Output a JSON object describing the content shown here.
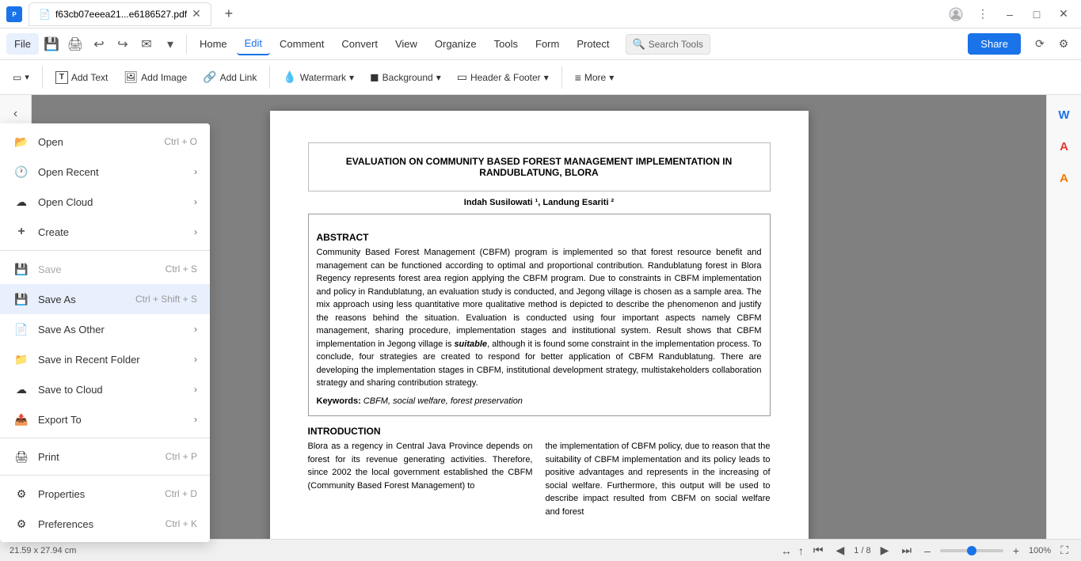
{
  "titleBar": {
    "tabTitle": "f63cb07eeea21...e6186527.pdf",
    "closeIcon": "✕",
    "addTabIcon": "+",
    "windowControls": [
      "–",
      "□",
      "✕"
    ]
  },
  "menuBar": {
    "fileLabel": "File",
    "items": [
      {
        "label": "Home",
        "active": false
      },
      {
        "label": "Edit",
        "active": true
      },
      {
        "label": "Comment",
        "active": false
      },
      {
        "label": "Convert",
        "active": false
      },
      {
        "label": "View",
        "active": false
      },
      {
        "label": "Organize",
        "active": false
      },
      {
        "label": "Tools",
        "active": false
      },
      {
        "label": "Form",
        "active": false
      },
      {
        "label": "Protect",
        "active": false
      }
    ],
    "searchPlaceholder": "Search Tools",
    "shareLabel": "Share"
  },
  "toolbar": {
    "items": [
      {
        "icon": "T",
        "label": "Add Text",
        "hasArrow": false
      },
      {
        "icon": "🖼",
        "label": "Add Image",
        "hasArrow": false
      },
      {
        "icon": "🔗",
        "label": "Add Link",
        "hasArrow": false
      },
      {
        "icon": "W",
        "label": "Watermark",
        "hasArrow": true
      },
      {
        "icon": "■",
        "label": "Background",
        "hasArrow": true
      },
      {
        "icon": "▭",
        "label": "Header & Footer",
        "hasArrow": true
      },
      {
        "icon": "≡",
        "label": "More",
        "hasArrow": true
      }
    ]
  },
  "fileMenu": {
    "items": [
      {
        "icon": "📂",
        "label": "Open",
        "shortcut": "Ctrl + O",
        "hasArrow": false,
        "disabled": false,
        "highlighted": false
      },
      {
        "icon": "🕐",
        "label": "Open Recent",
        "shortcut": "",
        "hasArrow": true,
        "disabled": false,
        "highlighted": false
      },
      {
        "icon": "☁",
        "label": "Open Cloud",
        "shortcut": "",
        "hasArrow": true,
        "disabled": false,
        "highlighted": false
      },
      {
        "icon": "+",
        "label": "Create",
        "shortcut": "",
        "hasArrow": true,
        "disabled": false,
        "highlighted": false
      },
      {
        "divider": true
      },
      {
        "icon": "💾",
        "label": "Save",
        "shortcut": "Ctrl + S",
        "hasArrow": false,
        "disabled": true,
        "highlighted": false
      },
      {
        "icon": "💾",
        "label": "Save As",
        "shortcut": "Ctrl + Shift + S",
        "hasArrow": false,
        "disabled": false,
        "highlighted": true
      },
      {
        "icon": "📄",
        "label": "Save As Other",
        "shortcut": "",
        "hasArrow": true,
        "disabled": false,
        "highlighted": false
      },
      {
        "icon": "📁",
        "label": "Save in Recent Folder",
        "shortcut": "",
        "hasArrow": true,
        "disabled": false,
        "highlighted": false
      },
      {
        "icon": "☁",
        "label": "Save to Cloud",
        "shortcut": "",
        "hasArrow": true,
        "disabled": false,
        "highlighted": false
      },
      {
        "icon": "📤",
        "label": "Export To",
        "shortcut": "",
        "hasArrow": true,
        "disabled": false,
        "highlighted": false
      },
      {
        "divider": true
      },
      {
        "icon": "🖨",
        "label": "Print",
        "shortcut": "Ctrl + P",
        "hasArrow": false,
        "disabled": false,
        "highlighted": false
      },
      {
        "divider": true
      },
      {
        "icon": "⚙",
        "label": "Properties",
        "shortcut": "Ctrl + D",
        "hasArrow": false,
        "disabled": false,
        "highlighted": false
      },
      {
        "icon": "⚙",
        "label": "Preferences",
        "shortcut": "Ctrl + K",
        "hasArrow": false,
        "disabled": false,
        "highlighted": false
      }
    ]
  },
  "pdfContent": {
    "title": "EVALUATION ON COMMUNITY BASED FOREST MANAGEMENT IMPLEMENTATION IN RANDUBLATUNG,  BLORA",
    "authors": "Indah Susilowati ¹, Landung Esariti ²",
    "abstractLabel": "ABSTRACT",
    "abstractText": "Community Based Forest Management (CBFM) program is implemented so that forest resource benefit and management can be functioned according to optimal and proportional contribution. Randublatung forest in Blora Regency represents forest area region applying the CBFM program. Due to constraints in CBFM implementation and policy in Randublatung, an evaluation study is conducted, and Jegong village is chosen as a sample area. The mix approach using less quantitative more qualitative method is depicted to describe the phenomenon and justify the reasons behind the situation. Evaluation is conducted using four important aspects namely CBFM management, sharing procedure, implementation stages and institutional system. Result shows that CBFM implementation in Jegong village is suitable, although it is found some constraint in the implementation process. To conclude, four strategies are created to respond for better application of CBFM Randublatung. There are developing the implementation stages in CBFM, institutional development strategy, multistakeholders collaboration strategy and sharing contribution strategy.",
    "keywordsLabel": "Keywords:",
    "keywords": "CBFM, social welfare, forest preservation",
    "introductionLabel": "INTRODUCTION",
    "col1Text": "Blora as a regency in Central Java Province depends on forest for its revenue generating activities. Therefore, since 2002 the local government established the CBFM (Community Based Forest Management) to",
    "col2Text": "the implementation of CBFM policy, due to reason that the suitability of CBFM implementation and its policy leads to positive advantages and represents in the increasing of social welfare. Furthermore, this output will be used to describe impact resulted from CBFM on social welfare and forest"
  },
  "statusBar": {
    "dimensions": "21.59 x 27.94 cm",
    "pageInfo": "1 / 8",
    "zoomLevel": "100%"
  },
  "rightPanel": {
    "icons": [
      {
        "name": "word-icon",
        "symbol": "W",
        "color": "active-blue"
      },
      {
        "name": "ai-icon",
        "symbol": "A",
        "color": "active-red"
      },
      {
        "name": "word2-icon",
        "symbol": "A",
        "color": "active-orange"
      }
    ]
  }
}
